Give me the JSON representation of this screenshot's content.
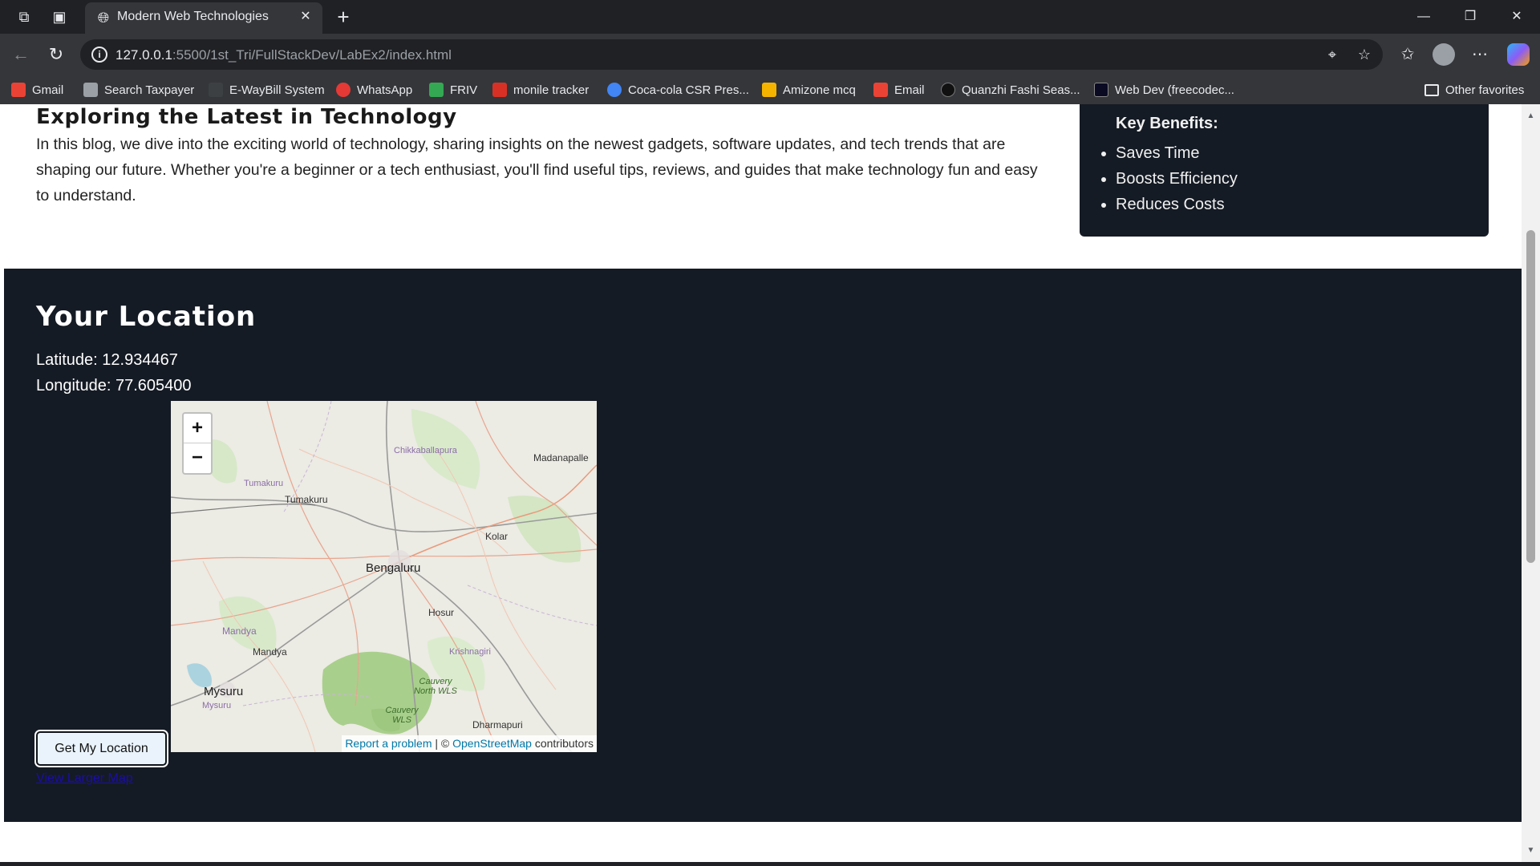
{
  "browser": {
    "tab_title": "Modern Web Technologies",
    "url_host": "127.0.0.1",
    "url_rest": ":5500/1st_Tri/FullStackDev/LabEx2/index.html",
    "bookmarks": [
      {
        "label": "Gmail",
        "icon": "gmail-icon",
        "color": "#ea4335"
      },
      {
        "label": "Search Taxpayer",
        "icon": "page-icon",
        "color": "#9aa0a6"
      },
      {
        "label": "E-WayBill System",
        "icon": "ewaybill-icon",
        "color": "#3c4043"
      },
      {
        "label": "WhatsApp",
        "icon": "whatsapp-icon",
        "color": "#e53935"
      },
      {
        "label": "FRIV",
        "icon": "friv-icon",
        "color": "#34a853"
      },
      {
        "label": "monile tracker",
        "icon": "tracker-icon",
        "color": "#d93025"
      },
      {
        "label": "Coca-cola CSR Pres...",
        "icon": "globe-icon",
        "color": "#4285f4"
      },
      {
        "label": "Amizone mcq",
        "icon": "amizone-icon",
        "color": "#f4b400"
      },
      {
        "label": "Email",
        "icon": "gmail-icon",
        "color": "#ea4335"
      },
      {
        "label": "Quanzhi Fashi Seas...",
        "icon": "quanzhi-icon",
        "color": "#111111"
      },
      {
        "label": "Web Dev (freecodec...",
        "icon": "freecodecamp-icon",
        "color": "#0a0a23"
      }
    ],
    "other_favorites": "Other favorites"
  },
  "page": {
    "blog_title": "Exploring the Latest in Technology",
    "blog_text": "In this blog, we dive into the exciting world of technology, sharing insights on the newest gadgets, software updates, and tech trends that are shaping our future. Whether you're a beginner or a tech enthusiast, you'll find useful tips, reviews, and guides that make technology fun and easy to understand.",
    "benefits_title": "Key Benefits:",
    "benefits": [
      "Saves Time",
      "Boosts Efficiency",
      "Reduces Costs"
    ],
    "location_title": "Your Location",
    "latitude_text": "Latitude: 12.934467",
    "longitude_text": "Longitude: 77.605400",
    "get_location_button": "Get My Location",
    "view_larger_link": "View Larger Map"
  },
  "map": {
    "zoom_in": "+",
    "zoom_out": "−",
    "attribution_report": "Report a problem",
    "attribution_sep": " | © ",
    "attribution_osm": "OpenStreetMap",
    "attribution_tail": " contributors",
    "places": {
      "chikkaballapura": "Chikkaballapura",
      "madanapalle": "Madanapalle",
      "tumakuru_district": "Tumakuru",
      "tumakuru": "Tumakuru",
      "kolar": "Kolar",
      "bengaluru": "Bengaluru",
      "hosur": "Hosur",
      "mandya_district": "Mandya",
      "mandya": "Mandya",
      "krishnagiri": "Krishnagiri",
      "cauvery_north": "Cauvery North WLS",
      "cauvery": "Cauvery WLS",
      "mysuru": "Mysuru",
      "mysuru_district": "Mysuru",
      "dharmapuri": "Dharmapuri"
    }
  },
  "colors": {
    "dark_panel": "#151b24",
    "link": "#1a0dab",
    "osm_link": "#0078a8"
  }
}
